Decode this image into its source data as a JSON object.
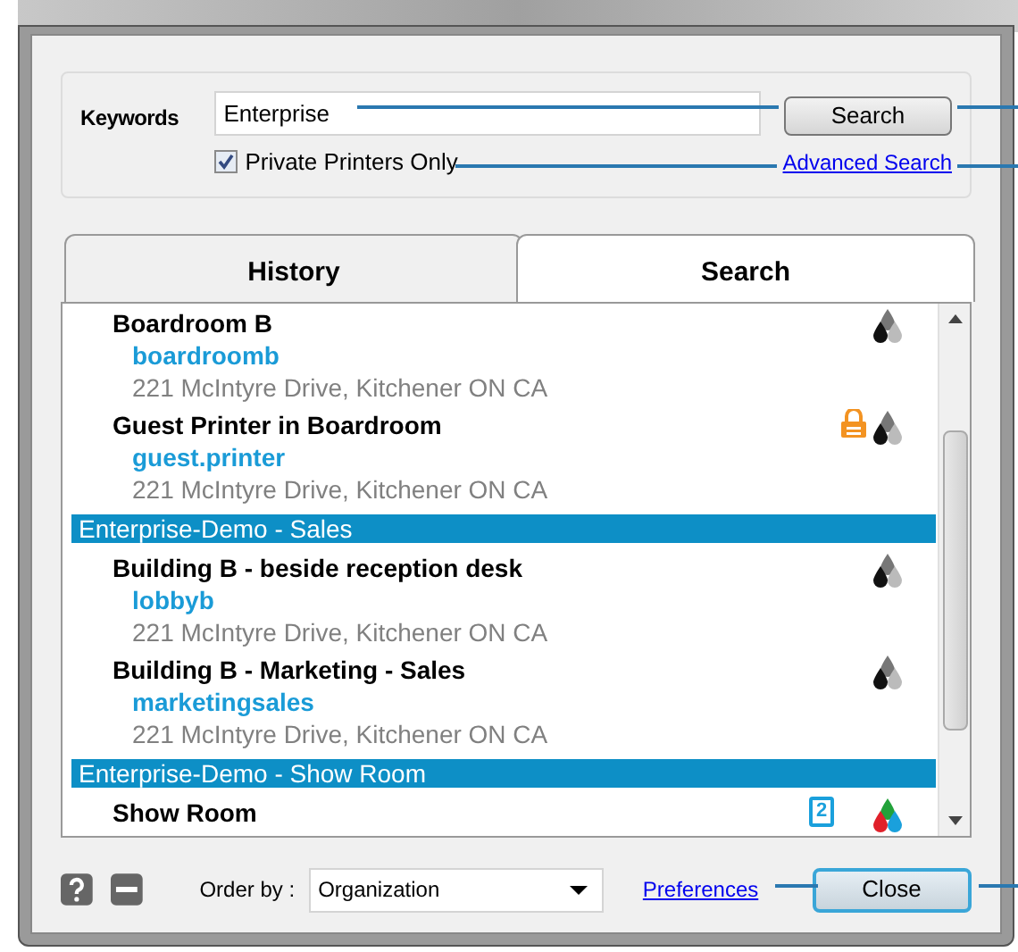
{
  "search_box": {
    "label": "Keywords",
    "value": "Enterprise",
    "button": "Search",
    "private_only": {
      "label": "Private Printers Only",
      "checked": true
    },
    "advanced_link": "Advanced Search"
  },
  "tabs": [
    {
      "label": "History",
      "selected": false
    },
    {
      "label": "Search",
      "selected": true
    }
  ],
  "results": [
    {
      "kind": "printer",
      "name": "Boardroom B",
      "queue": "boardroomb",
      "address": "221 McIntyre Drive, Kitchener ON CA",
      "locked": false,
      "color_printing": false
    },
    {
      "kind": "printer",
      "name": "Guest Printer in Boardroom",
      "queue": "guest.printer",
      "address": "221 McIntyre Drive, Kitchener ON CA",
      "locked": true,
      "color_printing": false
    },
    {
      "kind": "group",
      "name": "Enterprise-Demo - Sales"
    },
    {
      "kind": "printer",
      "name": "Building B - beside reception desk",
      "queue": "lobbyb",
      "address": "221 McIntyre Drive, Kitchener ON CA",
      "locked": false,
      "color_printing": false
    },
    {
      "kind": "printer",
      "name": "Building B - Marketing - Sales",
      "queue": "marketingsales",
      "address": "221 McIntyre Drive, Kitchener ON CA",
      "locked": false,
      "color_printing": false
    },
    {
      "kind": "group",
      "name": "Enterprise-Demo - Show Room"
    },
    {
      "kind": "printer",
      "name": "Show Room",
      "duplex": "2",
      "locked": false,
      "color_printing": true
    }
  ],
  "footer": {
    "order_label": "Order by :",
    "order_value": "Organization",
    "preferences_link": "Preferences",
    "close_button": "Close"
  }
}
